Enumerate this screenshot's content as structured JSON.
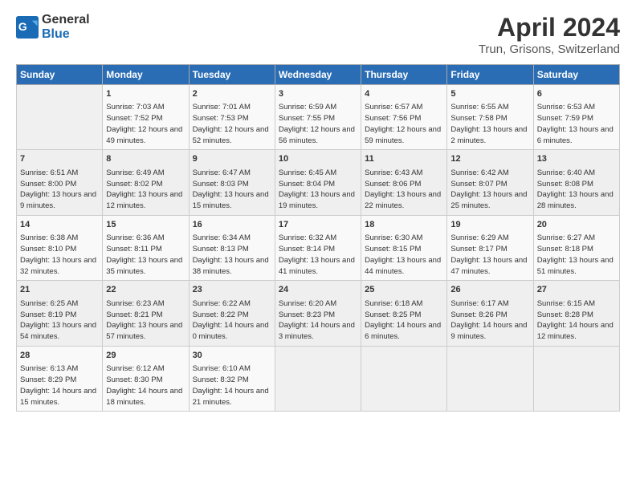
{
  "header": {
    "logo_line1": "General",
    "logo_line2": "Blue",
    "title": "April 2024",
    "subtitle": "Trun, Grisons, Switzerland"
  },
  "weekdays": [
    "Sunday",
    "Monday",
    "Tuesday",
    "Wednesday",
    "Thursday",
    "Friday",
    "Saturday"
  ],
  "weeks": [
    [
      {
        "day": "",
        "sunrise": "",
        "sunset": "",
        "daylight": ""
      },
      {
        "day": "1",
        "sunrise": "Sunrise: 7:03 AM",
        "sunset": "Sunset: 7:52 PM",
        "daylight": "Daylight: 12 hours and 49 minutes."
      },
      {
        "day": "2",
        "sunrise": "Sunrise: 7:01 AM",
        "sunset": "Sunset: 7:53 PM",
        "daylight": "Daylight: 12 hours and 52 minutes."
      },
      {
        "day": "3",
        "sunrise": "Sunrise: 6:59 AM",
        "sunset": "Sunset: 7:55 PM",
        "daylight": "Daylight: 12 hours and 56 minutes."
      },
      {
        "day": "4",
        "sunrise": "Sunrise: 6:57 AM",
        "sunset": "Sunset: 7:56 PM",
        "daylight": "Daylight: 12 hours and 59 minutes."
      },
      {
        "day": "5",
        "sunrise": "Sunrise: 6:55 AM",
        "sunset": "Sunset: 7:58 PM",
        "daylight": "Daylight: 13 hours and 2 minutes."
      },
      {
        "day": "6",
        "sunrise": "Sunrise: 6:53 AM",
        "sunset": "Sunset: 7:59 PM",
        "daylight": "Daylight: 13 hours and 6 minutes."
      }
    ],
    [
      {
        "day": "7",
        "sunrise": "Sunrise: 6:51 AM",
        "sunset": "Sunset: 8:00 PM",
        "daylight": "Daylight: 13 hours and 9 minutes."
      },
      {
        "day": "8",
        "sunrise": "Sunrise: 6:49 AM",
        "sunset": "Sunset: 8:02 PM",
        "daylight": "Daylight: 13 hours and 12 minutes."
      },
      {
        "day": "9",
        "sunrise": "Sunrise: 6:47 AM",
        "sunset": "Sunset: 8:03 PM",
        "daylight": "Daylight: 13 hours and 15 minutes."
      },
      {
        "day": "10",
        "sunrise": "Sunrise: 6:45 AM",
        "sunset": "Sunset: 8:04 PM",
        "daylight": "Daylight: 13 hours and 19 minutes."
      },
      {
        "day": "11",
        "sunrise": "Sunrise: 6:43 AM",
        "sunset": "Sunset: 8:06 PM",
        "daylight": "Daylight: 13 hours and 22 minutes."
      },
      {
        "day": "12",
        "sunrise": "Sunrise: 6:42 AM",
        "sunset": "Sunset: 8:07 PM",
        "daylight": "Daylight: 13 hours and 25 minutes."
      },
      {
        "day": "13",
        "sunrise": "Sunrise: 6:40 AM",
        "sunset": "Sunset: 8:08 PM",
        "daylight": "Daylight: 13 hours and 28 minutes."
      }
    ],
    [
      {
        "day": "14",
        "sunrise": "Sunrise: 6:38 AM",
        "sunset": "Sunset: 8:10 PM",
        "daylight": "Daylight: 13 hours and 32 minutes."
      },
      {
        "day": "15",
        "sunrise": "Sunrise: 6:36 AM",
        "sunset": "Sunset: 8:11 PM",
        "daylight": "Daylight: 13 hours and 35 minutes."
      },
      {
        "day": "16",
        "sunrise": "Sunrise: 6:34 AM",
        "sunset": "Sunset: 8:13 PM",
        "daylight": "Daylight: 13 hours and 38 minutes."
      },
      {
        "day": "17",
        "sunrise": "Sunrise: 6:32 AM",
        "sunset": "Sunset: 8:14 PM",
        "daylight": "Daylight: 13 hours and 41 minutes."
      },
      {
        "day": "18",
        "sunrise": "Sunrise: 6:30 AM",
        "sunset": "Sunset: 8:15 PM",
        "daylight": "Daylight: 13 hours and 44 minutes."
      },
      {
        "day": "19",
        "sunrise": "Sunrise: 6:29 AM",
        "sunset": "Sunset: 8:17 PM",
        "daylight": "Daylight: 13 hours and 47 minutes."
      },
      {
        "day": "20",
        "sunrise": "Sunrise: 6:27 AM",
        "sunset": "Sunset: 8:18 PM",
        "daylight": "Daylight: 13 hours and 51 minutes."
      }
    ],
    [
      {
        "day": "21",
        "sunrise": "Sunrise: 6:25 AM",
        "sunset": "Sunset: 8:19 PM",
        "daylight": "Daylight: 13 hours and 54 minutes."
      },
      {
        "day": "22",
        "sunrise": "Sunrise: 6:23 AM",
        "sunset": "Sunset: 8:21 PM",
        "daylight": "Daylight: 13 hours and 57 minutes."
      },
      {
        "day": "23",
        "sunrise": "Sunrise: 6:22 AM",
        "sunset": "Sunset: 8:22 PM",
        "daylight": "Daylight: 14 hours and 0 minutes."
      },
      {
        "day": "24",
        "sunrise": "Sunrise: 6:20 AM",
        "sunset": "Sunset: 8:23 PM",
        "daylight": "Daylight: 14 hours and 3 minutes."
      },
      {
        "day": "25",
        "sunrise": "Sunrise: 6:18 AM",
        "sunset": "Sunset: 8:25 PM",
        "daylight": "Daylight: 14 hours and 6 minutes."
      },
      {
        "day": "26",
        "sunrise": "Sunrise: 6:17 AM",
        "sunset": "Sunset: 8:26 PM",
        "daylight": "Daylight: 14 hours and 9 minutes."
      },
      {
        "day": "27",
        "sunrise": "Sunrise: 6:15 AM",
        "sunset": "Sunset: 8:28 PM",
        "daylight": "Daylight: 14 hours and 12 minutes."
      }
    ],
    [
      {
        "day": "28",
        "sunrise": "Sunrise: 6:13 AM",
        "sunset": "Sunset: 8:29 PM",
        "daylight": "Daylight: 14 hours and 15 minutes."
      },
      {
        "day": "29",
        "sunrise": "Sunrise: 6:12 AM",
        "sunset": "Sunset: 8:30 PM",
        "daylight": "Daylight: 14 hours and 18 minutes."
      },
      {
        "day": "30",
        "sunrise": "Sunrise: 6:10 AM",
        "sunset": "Sunset: 8:32 PM",
        "daylight": "Daylight: 14 hours and 21 minutes."
      },
      {
        "day": "",
        "sunrise": "",
        "sunset": "",
        "daylight": ""
      },
      {
        "day": "",
        "sunrise": "",
        "sunset": "",
        "daylight": ""
      },
      {
        "day": "",
        "sunrise": "",
        "sunset": "",
        "daylight": ""
      },
      {
        "day": "",
        "sunrise": "",
        "sunset": "",
        "daylight": ""
      }
    ]
  ]
}
